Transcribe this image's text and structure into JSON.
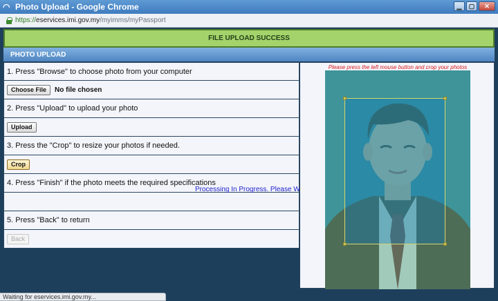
{
  "window": {
    "title": "Photo Upload - Google Chrome",
    "buttons": [
      "minimize",
      "maximize",
      "close"
    ]
  },
  "address": {
    "scheme": "https://",
    "host": "eservices.imi.gov.my",
    "path": "/myimms/myPassport"
  },
  "banner": {
    "success": "FILE UPLOAD SUCCESS"
  },
  "section": {
    "title": "PHOTO UPLOAD"
  },
  "steps": {
    "step1": "1. Press \"Browse\" to choose photo from your computer",
    "choose_file": "Choose File",
    "no_file": "No file chosen",
    "step2": "2. Press \"Upload\" to upload your photo",
    "upload": "Upload",
    "step3": "3. Press the \"Crop\" to resize your photos if needed.",
    "crop": "Crop",
    "step4": "4. Press \"Finish\" if the photo meets the required specifications",
    "step5": "5. Press \"Back\" to return",
    "back": "Back"
  },
  "processing": "Processing In Progress. Please Wait . . .",
  "photo_panel": {
    "hint": "Please press the left mouse button and crop your photos"
  },
  "status": "Waiting for eservices.imi.gov.my...",
  "colors": {
    "success_bg": "#a3d36a",
    "section_bg": "#4f85c2",
    "photo_bg": "#177aa7",
    "hint_text": "#d61a1a",
    "processing_text": "#2222cc"
  }
}
